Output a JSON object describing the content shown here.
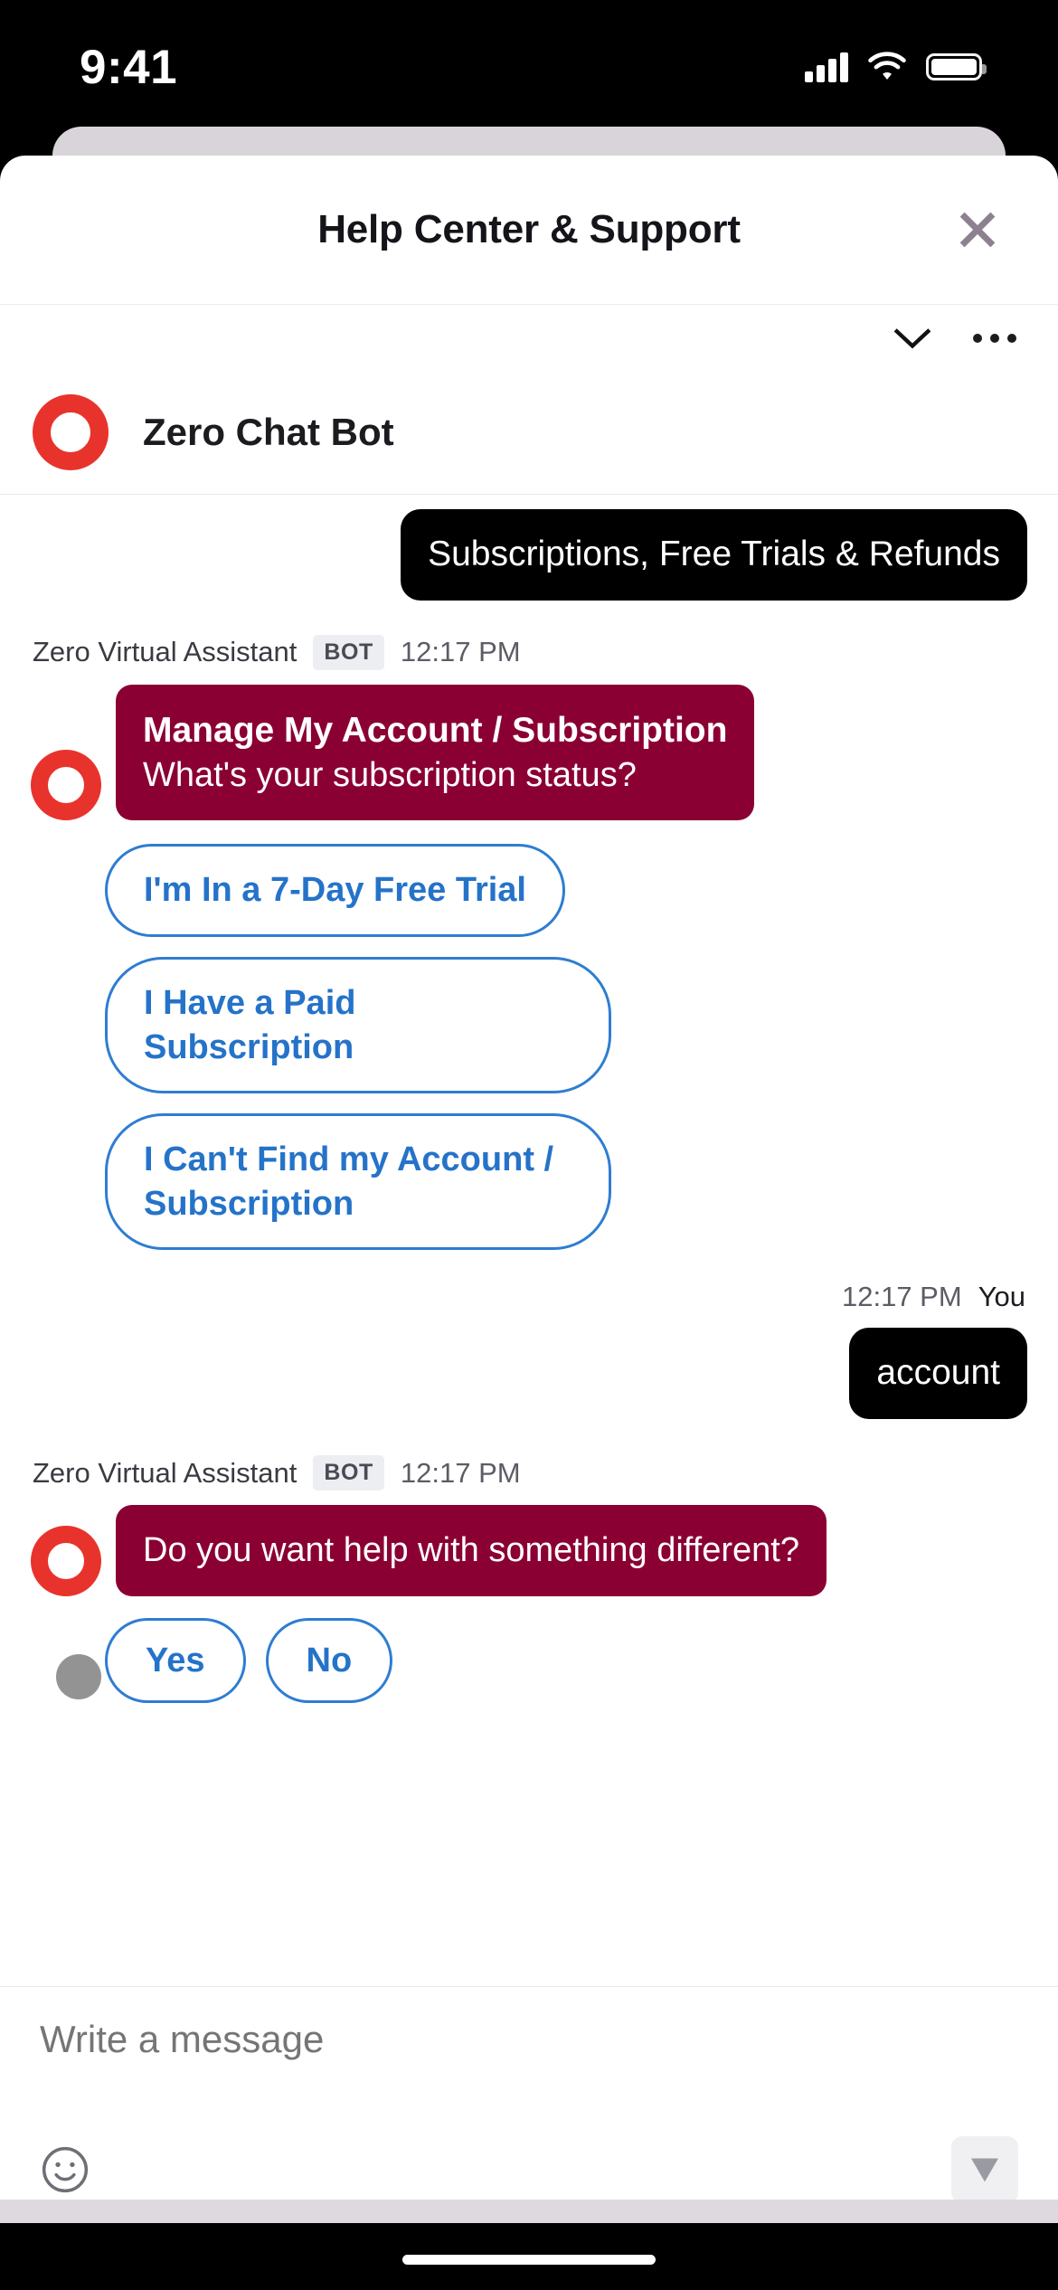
{
  "status_bar": {
    "time": "9:41",
    "signal_icon": "cellular-signal-icon",
    "wifi_icon": "wifi-icon",
    "battery_icon": "battery-icon"
  },
  "sheet": {
    "title": "Help Center & Support",
    "close_icon": "close-icon"
  },
  "bot_header": {
    "name": "Zero Chat Bot",
    "avatar_icon": "bot-avatar-ring-icon",
    "collapse_icon": "chevron-down-icon",
    "menu_icon": "more-options-icon"
  },
  "conversation": [
    {
      "id": "user-topic",
      "sender": "user",
      "text": "Subscriptions, Free Trials & Refunds"
    },
    {
      "id": "bot-subscription-status",
      "sender": "bot",
      "author": "Zero Virtual Assistant",
      "badge": "BOT",
      "time": "12:17 PM",
      "title": "Manage My Account / Subscription",
      "body": "What's your subscription status?",
      "options": [
        "I'm In a 7-Day Free Trial",
        "I Have a Paid Subscription",
        "I Can't Find my Account / Subscription"
      ]
    },
    {
      "id": "user-account",
      "sender": "user",
      "time": "12:17 PM",
      "who": "You",
      "text": "account"
    },
    {
      "id": "bot-something-different",
      "sender": "bot",
      "author": "Zero Virtual Assistant",
      "badge": "BOT",
      "time": "12:17 PM",
      "body": "Do you want help with something different?",
      "options": [
        "Yes",
        "No"
      ]
    }
  ],
  "composer": {
    "placeholder": "Write a message",
    "value": "",
    "emoji_icon": "emoji-smiley-icon",
    "send_icon": "send-icon"
  },
  "colors": {
    "bot_bubble": "#8b0033",
    "user_bubble": "#000000",
    "option_blue": "#2e7dd1",
    "avatar_red": "#e8332c",
    "badge_bg": "#eceef1"
  }
}
